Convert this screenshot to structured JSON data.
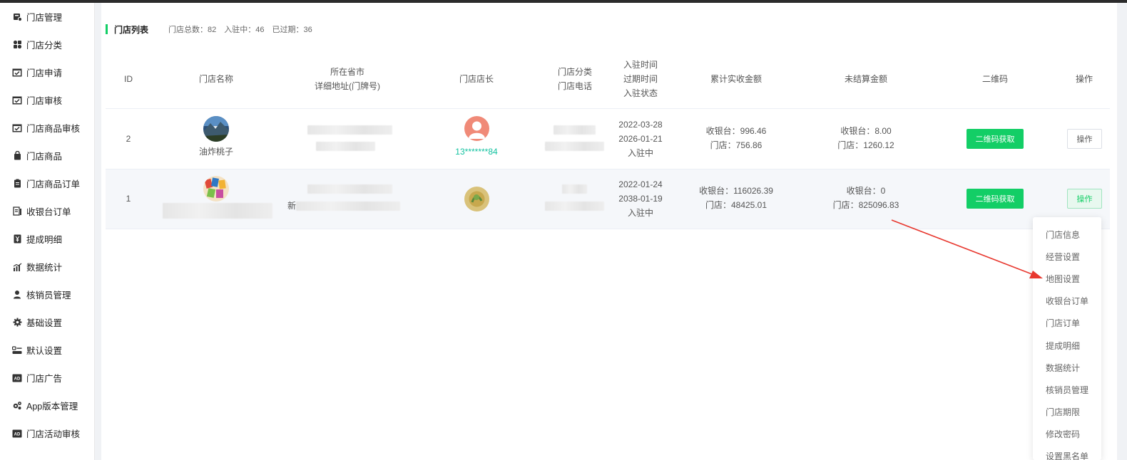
{
  "sidebar": {
    "items": [
      {
        "label": "门店管理",
        "icon": "store-icon"
      },
      {
        "label": "门店分类",
        "icon": "category-icon"
      },
      {
        "label": "门店申请",
        "icon": "inbox-check-icon"
      },
      {
        "label": "门店审核",
        "icon": "inbox-check-icon"
      },
      {
        "label": "门店商品审核",
        "icon": "inbox-check-icon"
      },
      {
        "label": "门店商品",
        "icon": "bag-icon"
      },
      {
        "label": "门店商品订单",
        "icon": "clipboard-icon"
      },
      {
        "label": "收银台订单",
        "icon": "receipt-icon"
      },
      {
        "label": "提成明细",
        "icon": "yen-icon"
      },
      {
        "label": "数据统计",
        "icon": "bar-chart-icon"
      },
      {
        "label": "核销员管理",
        "icon": "user-icon"
      },
      {
        "label": "基础设置",
        "icon": "gear-icon"
      },
      {
        "label": "默认设置",
        "icon": "toggle-list-icon"
      },
      {
        "label": "门店广告",
        "icon": "ad-icon"
      },
      {
        "label": "App版本管理",
        "icon": "gears-icon"
      },
      {
        "label": "门店活动审核",
        "icon": "ad-icon"
      }
    ]
  },
  "list": {
    "title": "门店列表",
    "total": "门店总数：82",
    "active": "入驻中：46",
    "expired": "已过期：36"
  },
  "columns": {
    "id": "ID",
    "name": "门店名称",
    "city": "所在省市",
    "address": "详细地址(门牌号)",
    "manager": "门店店长",
    "category": "门店分类",
    "phone": "门店电话",
    "join_time": "入驻时间",
    "expire_time": "过期时间",
    "join_status": "入驻状态",
    "total_amount": "累计实收金额",
    "unsettled": "未结算金额",
    "qrcode": "二维码",
    "actions": "操作"
  },
  "rows": [
    {
      "id": "2",
      "name": "油炸桃子",
      "manager_phone": "13*******84",
      "join_date": "2022-03-28",
      "expire_date": "2026-01-21",
      "status": "入驻中",
      "total_cashier": "收银台：996.46",
      "total_store": "门店：756.86",
      "unsettled_cashier": "收银台：8.00",
      "unsettled_store": "门店：1260.12",
      "qr_label": "二维码获取",
      "op_label": "操作"
    },
    {
      "id": "1",
      "address_prefix": "新",
      "join_date": "2022-01-24",
      "expire_date": "2038-01-19",
      "status": "入驻中",
      "total_cashier": "收银台：116026.39",
      "total_store": "门店：48425.01",
      "unsettled_cashier": "收银台：0",
      "unsettled_store": "门店：825096.83",
      "qr_label": "二维码获取",
      "op_label": "操作"
    }
  ],
  "dropdown": {
    "items": [
      "门店信息",
      "经营设置",
      "地图设置",
      "收银台订单",
      "门店订单",
      "提成明细",
      "数据统计",
      "核销员管理",
      "门店期限",
      "修改密码",
      "设置黑名单"
    ]
  },
  "colors": {
    "accent": "#13ce66",
    "arrow": "#e8382f",
    "phone_text": "#13c2a0"
  }
}
